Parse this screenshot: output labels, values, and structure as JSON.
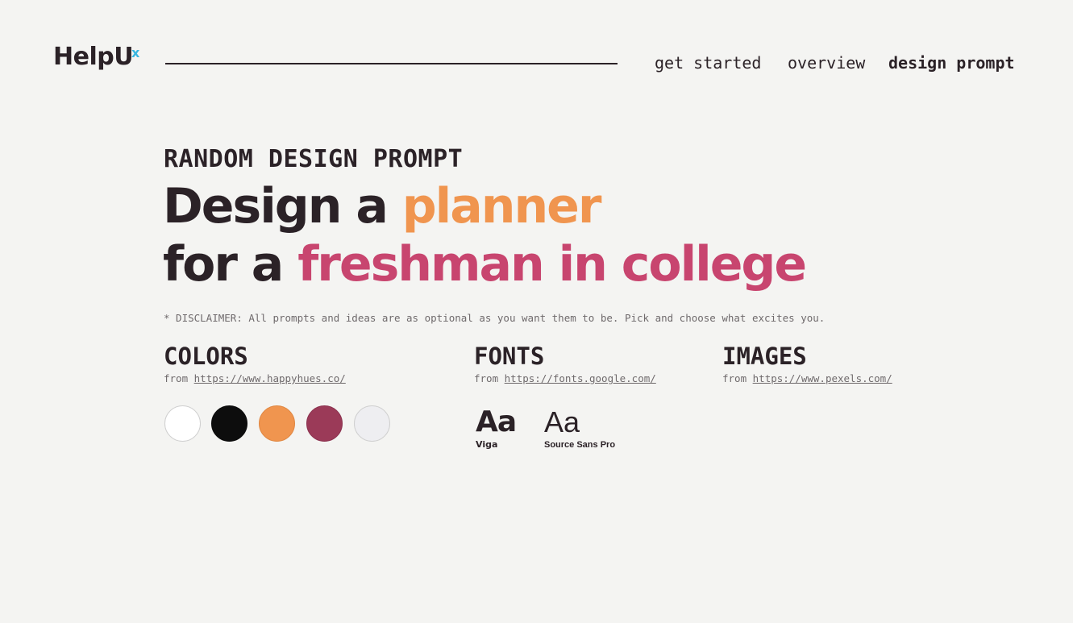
{
  "header": {
    "logo": "HelpU",
    "logo_superscript": "x",
    "nav": [
      {
        "label": "get started"
      },
      {
        "label": "overview"
      },
      {
        "label": "design prompt"
      }
    ]
  },
  "hero": {
    "eyebrow": "RANDOM DESIGN PROMPT",
    "line1_prefix": "Design a ",
    "line1_accent": "planner",
    "line2_prefix": "for a ",
    "line2_accent": "freshman in college",
    "disclaimer": "* DISCLAIMER: All prompts and ideas are as optional as you want them to be. Pick and choose what excites you."
  },
  "colors_section": {
    "title": "COLORS",
    "from_label": "from",
    "link": "https://www.happyhues.co/",
    "swatches": [
      {
        "color": "#ffffff",
        "border": "#cfcfcf"
      },
      {
        "color": "#0d0d0d",
        "border": "#0d0d0d"
      },
      {
        "color": "#f0954f",
        "border": "#e08843"
      },
      {
        "color": "#9b3a58",
        "border": "#8c3350"
      },
      {
        "color": "#eeeef1",
        "border": "#cfcfcf"
      }
    ]
  },
  "fonts_section": {
    "title": "FONTS",
    "from_label": "from",
    "link": "https://fonts.google.com/",
    "fonts": [
      {
        "glyph": "Aa",
        "name": "Viga"
      },
      {
        "glyph": "Aa",
        "name": "Source Sans Pro"
      }
    ]
  },
  "images_section": {
    "title": "IMAGES",
    "from_label": "from",
    "link": "https://www.pexels.com/"
  }
}
